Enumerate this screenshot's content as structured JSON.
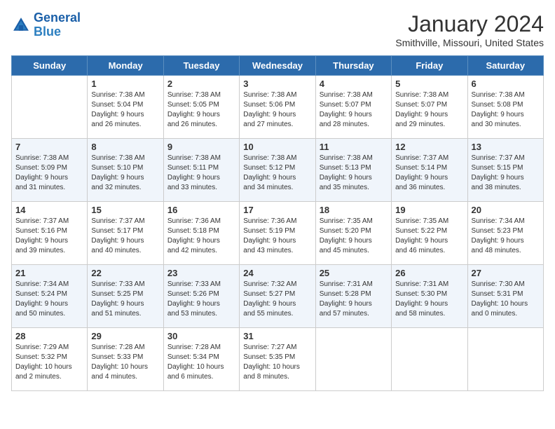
{
  "logo": {
    "line1": "General",
    "line2": "Blue"
  },
  "title": "January 2024",
  "location": "Smithville, Missouri, United States",
  "days_of_week": [
    "Sunday",
    "Monday",
    "Tuesday",
    "Wednesday",
    "Thursday",
    "Friday",
    "Saturday"
  ],
  "weeks": [
    [
      {
        "num": "",
        "info": ""
      },
      {
        "num": "1",
        "info": "Sunrise: 7:38 AM\nSunset: 5:04 PM\nDaylight: 9 hours\nand 26 minutes."
      },
      {
        "num": "2",
        "info": "Sunrise: 7:38 AM\nSunset: 5:05 PM\nDaylight: 9 hours\nand 26 minutes."
      },
      {
        "num": "3",
        "info": "Sunrise: 7:38 AM\nSunset: 5:06 PM\nDaylight: 9 hours\nand 27 minutes."
      },
      {
        "num": "4",
        "info": "Sunrise: 7:38 AM\nSunset: 5:07 PM\nDaylight: 9 hours\nand 28 minutes."
      },
      {
        "num": "5",
        "info": "Sunrise: 7:38 AM\nSunset: 5:07 PM\nDaylight: 9 hours\nand 29 minutes."
      },
      {
        "num": "6",
        "info": "Sunrise: 7:38 AM\nSunset: 5:08 PM\nDaylight: 9 hours\nand 30 minutes."
      }
    ],
    [
      {
        "num": "7",
        "info": "Sunrise: 7:38 AM\nSunset: 5:09 PM\nDaylight: 9 hours\nand 31 minutes."
      },
      {
        "num": "8",
        "info": "Sunrise: 7:38 AM\nSunset: 5:10 PM\nDaylight: 9 hours\nand 32 minutes."
      },
      {
        "num": "9",
        "info": "Sunrise: 7:38 AM\nSunset: 5:11 PM\nDaylight: 9 hours\nand 33 minutes."
      },
      {
        "num": "10",
        "info": "Sunrise: 7:38 AM\nSunset: 5:12 PM\nDaylight: 9 hours\nand 34 minutes."
      },
      {
        "num": "11",
        "info": "Sunrise: 7:38 AM\nSunset: 5:13 PM\nDaylight: 9 hours\nand 35 minutes."
      },
      {
        "num": "12",
        "info": "Sunrise: 7:37 AM\nSunset: 5:14 PM\nDaylight: 9 hours\nand 36 minutes."
      },
      {
        "num": "13",
        "info": "Sunrise: 7:37 AM\nSunset: 5:15 PM\nDaylight: 9 hours\nand 38 minutes."
      }
    ],
    [
      {
        "num": "14",
        "info": "Sunrise: 7:37 AM\nSunset: 5:16 PM\nDaylight: 9 hours\nand 39 minutes."
      },
      {
        "num": "15",
        "info": "Sunrise: 7:37 AM\nSunset: 5:17 PM\nDaylight: 9 hours\nand 40 minutes."
      },
      {
        "num": "16",
        "info": "Sunrise: 7:36 AM\nSunset: 5:18 PM\nDaylight: 9 hours\nand 42 minutes."
      },
      {
        "num": "17",
        "info": "Sunrise: 7:36 AM\nSunset: 5:19 PM\nDaylight: 9 hours\nand 43 minutes."
      },
      {
        "num": "18",
        "info": "Sunrise: 7:35 AM\nSunset: 5:20 PM\nDaylight: 9 hours\nand 45 minutes."
      },
      {
        "num": "19",
        "info": "Sunrise: 7:35 AM\nSunset: 5:22 PM\nDaylight: 9 hours\nand 46 minutes."
      },
      {
        "num": "20",
        "info": "Sunrise: 7:34 AM\nSunset: 5:23 PM\nDaylight: 9 hours\nand 48 minutes."
      }
    ],
    [
      {
        "num": "21",
        "info": "Sunrise: 7:34 AM\nSunset: 5:24 PM\nDaylight: 9 hours\nand 50 minutes."
      },
      {
        "num": "22",
        "info": "Sunrise: 7:33 AM\nSunset: 5:25 PM\nDaylight: 9 hours\nand 51 minutes."
      },
      {
        "num": "23",
        "info": "Sunrise: 7:33 AM\nSunset: 5:26 PM\nDaylight: 9 hours\nand 53 minutes."
      },
      {
        "num": "24",
        "info": "Sunrise: 7:32 AM\nSunset: 5:27 PM\nDaylight: 9 hours\nand 55 minutes."
      },
      {
        "num": "25",
        "info": "Sunrise: 7:31 AM\nSunset: 5:28 PM\nDaylight: 9 hours\nand 57 minutes."
      },
      {
        "num": "26",
        "info": "Sunrise: 7:31 AM\nSunset: 5:30 PM\nDaylight: 9 hours\nand 58 minutes."
      },
      {
        "num": "27",
        "info": "Sunrise: 7:30 AM\nSunset: 5:31 PM\nDaylight: 10 hours\nand 0 minutes."
      }
    ],
    [
      {
        "num": "28",
        "info": "Sunrise: 7:29 AM\nSunset: 5:32 PM\nDaylight: 10 hours\nand 2 minutes."
      },
      {
        "num": "29",
        "info": "Sunrise: 7:28 AM\nSunset: 5:33 PM\nDaylight: 10 hours\nand 4 minutes."
      },
      {
        "num": "30",
        "info": "Sunrise: 7:28 AM\nSunset: 5:34 PM\nDaylight: 10 hours\nand 6 minutes."
      },
      {
        "num": "31",
        "info": "Sunrise: 7:27 AM\nSunset: 5:35 PM\nDaylight: 10 hours\nand 8 minutes."
      },
      {
        "num": "",
        "info": ""
      },
      {
        "num": "",
        "info": ""
      },
      {
        "num": "",
        "info": ""
      }
    ]
  ]
}
